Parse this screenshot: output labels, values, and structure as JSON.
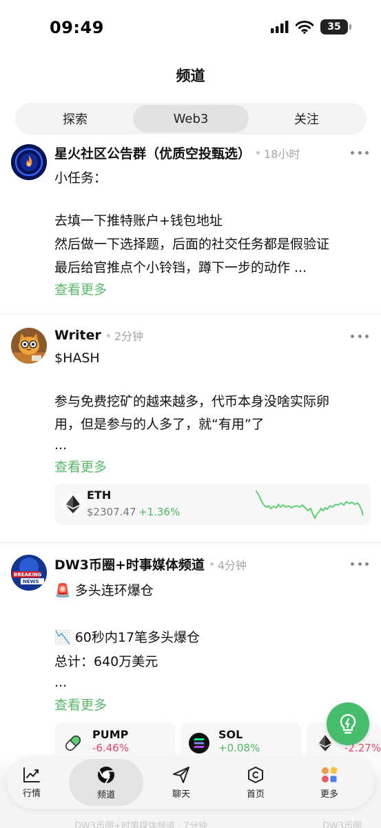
{
  "status_bar": {
    "time": "09:49",
    "battery": "35"
  },
  "header": {
    "title": "频道"
  },
  "tabs": [
    {
      "label": "探索",
      "active": false
    },
    {
      "label": "Web3",
      "active": true
    },
    {
      "label": "关注",
      "active": false
    }
  ],
  "posts": [
    {
      "author": "星火社区公告群（优质空投甄选）",
      "time": "18小时",
      "lines": [
        "小任务：",
        "",
        "去填一下推特账户+钱包地址",
        "然后做一下选择题，后面的社交任务都是假验证",
        "最后给官推点个小铃铛，蹲下一步的动作 ..."
      ],
      "see_more": "查看更多"
    },
    {
      "author": "Writer",
      "time": "2分钟",
      "lines": [
        "$HASH",
        "",
        "参与免费挖矿的越来越多，代币本身没啥实际卵",
        "用，但是参与的人多了，就“有用”了",
        "..."
      ],
      "see_more": "查看更多",
      "token": {
        "symbol": "ETH",
        "price": "$2307.47",
        "change": "+1.36%",
        "icon": "ethereum-icon"
      }
    },
    {
      "author": "DW3币圈+时事媒体频道",
      "time": "4分钟",
      "lines": [
        "🚨 多头连环爆仓",
        "",
        "📉 60秒内17笔多头爆仓",
        "总计：640万美元",
        "..."
      ],
      "see_more": "查看更多",
      "tokens": [
        {
          "symbol": "PUMP",
          "change": "-6.46%",
          "icon": "pill-icon"
        },
        {
          "symbol": "SOL",
          "change": "+0.08%",
          "icon": "solana-icon"
        },
        {
          "symbol": "",
          "change": "-2.27%",
          "icon": "ethereum-icon"
        }
      ]
    }
  ],
  "bottom_nav": [
    {
      "label": "行情",
      "icon": "market-chart-icon"
    },
    {
      "label": "频道",
      "icon": "channel-icon",
      "active": true
    },
    {
      "label": "聊天",
      "icon": "send-icon"
    },
    {
      "label": "首页",
      "icon": "home-coin-icon"
    },
    {
      "label": "更多",
      "icon": "apps-grid-icon"
    }
  ],
  "ghost_text": {
    "left": "DW3币圈+时事媒体频道 · 7分钟",
    "right": "DW3币圈"
  },
  "colors": {
    "accent_green": "#59b96a",
    "down_red": "#e0476b",
    "fab_green": "#45bd6a"
  }
}
